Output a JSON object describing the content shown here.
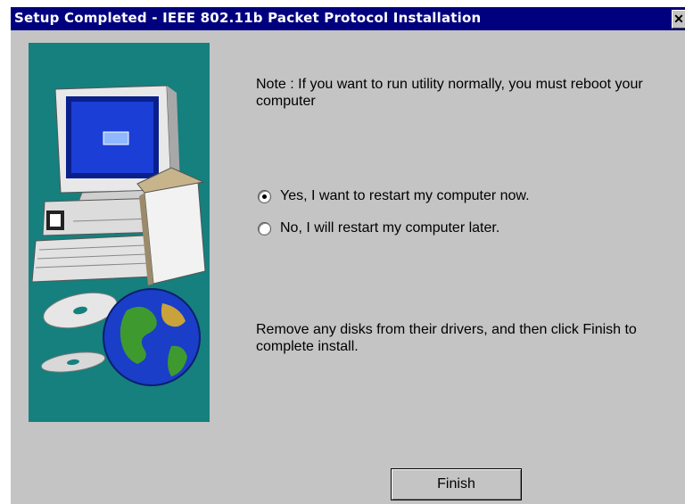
{
  "window": {
    "title": "Setup Completed - IEEE 802.11b Packet Protocol Installation",
    "close_glyph": "✕"
  },
  "content": {
    "note": "Note : If you want to run utility normally, you must reboot your computer",
    "options": [
      {
        "label": "Yes, I want to restart my computer now.",
        "selected": true
      },
      {
        "label": "No, I will restart my computer later.",
        "selected": false
      }
    ],
    "instructions": "Remove any disks from their drivers, and then click Finish to complete install."
  },
  "buttons": {
    "finish": "Finish"
  },
  "colors": {
    "titlebar": "#00007f",
    "panel": "#15807e",
    "background": "#c4c4c4"
  }
}
